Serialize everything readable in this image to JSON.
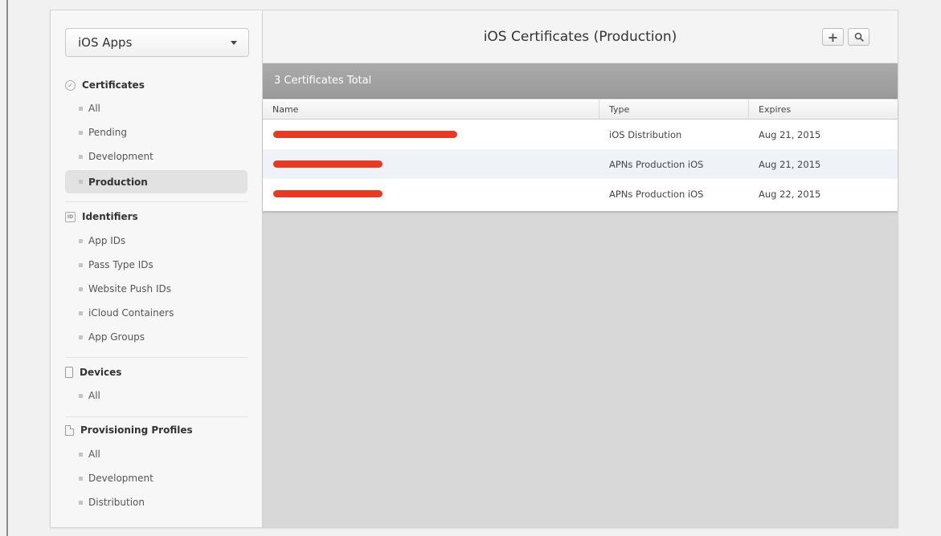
{
  "sidebar": {
    "app_select": {
      "label": "iOS Apps"
    },
    "sections": {
      "certificates": {
        "title": "Certificates",
        "icon": "certificate-icon",
        "items": [
          "All",
          "Pending",
          "Development",
          "Production"
        ],
        "selected": "Production"
      },
      "identifiers": {
        "title": "Identifiers",
        "icon": "identifier-icon",
        "icon_text": "ID",
        "items": [
          "App IDs",
          "Pass Type IDs",
          "Website Push IDs",
          "iCloud Containers",
          "App Groups"
        ]
      },
      "devices": {
        "title": "Devices",
        "icon": "device-icon",
        "items": [
          "All"
        ]
      },
      "provisioning": {
        "title": "Provisioning Profiles",
        "icon": "document-icon",
        "items": [
          "All",
          "Development",
          "Distribution"
        ]
      }
    }
  },
  "main": {
    "title": "iOS Certificates (Production)",
    "toolbar": {
      "add_icon": "plus-icon",
      "add_glyph": "+",
      "search_icon": "search-icon"
    },
    "total_label": "3 Certificates Total",
    "table": {
      "columns": [
        "Name",
        "Type",
        "Expires"
      ],
      "rows": [
        {
          "name": "[redacted]",
          "type": "iOS Distribution",
          "expires": "Aug 21, 2015"
        },
        {
          "name": "[redacted]",
          "type": "APNs Production iOS",
          "expires": "Aug 21, 2015"
        },
        {
          "name": "[redacted]",
          "type": "APNs Production iOS",
          "expires": "Aug 22, 2015"
        }
      ]
    }
  },
  "colors": {
    "redaction": "#e53b25",
    "total_bar": "#a3a3a3",
    "content_bg": "#d8d8d8"
  }
}
